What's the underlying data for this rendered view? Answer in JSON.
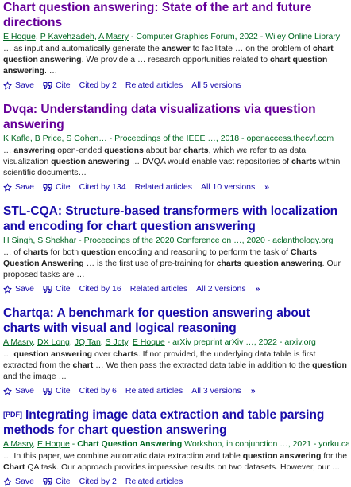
{
  "results": [
    {
      "pdf": "",
      "title": [
        [
          "Chart question answering",
          true
        ],
        [
          ": State of the art and future directions",
          false
        ]
      ],
      "visited": true,
      "authors": [
        "E Hoque",
        "P Kavehzadeh",
        "A Masry"
      ],
      "source": " - Computer Graphics Forum, 2022 - Wiley Online Library",
      "snippet": [
        [
          "… as input and automatically generate the ",
          false
        ],
        [
          "answer",
          true
        ],
        [
          " to facilitate … on the problem of ",
          false
        ],
        [
          "chart question answering",
          true
        ],
        [
          ". We provide a … research opportunities related to ",
          false
        ],
        [
          "chart question answering",
          true
        ],
        [
          ". …",
          false
        ]
      ],
      "save": "Save",
      "cite": "Cite",
      "cited_by": "Cited by 2",
      "related": "Related articles",
      "versions": "All 5 versions",
      "has_more": false
    },
    {
      "pdf": "",
      "title": [
        [
          "Dvqa: Understanding data visualizations via ",
          false
        ],
        [
          "question answering",
          true
        ]
      ],
      "visited": true,
      "authors": [
        "K Kafle",
        "B Price",
        "S Cohen…"
      ],
      "source": " - Proceedings of the IEEE …, 2018 - openaccess.thecvf.com",
      "snippet": [
        [
          "… ",
          false
        ],
        [
          "answering",
          true
        ],
        [
          " open-ended ",
          false
        ],
        [
          "questions",
          true
        ],
        [
          " about bar ",
          false
        ],
        [
          "charts",
          true
        ],
        [
          ", which we refer to as data visualization ",
          false
        ],
        [
          "question answering",
          true
        ],
        [
          " … DVQA would enable vast repositories of ",
          false
        ],
        [
          "charts",
          true
        ],
        [
          " within scientific documents…",
          false
        ]
      ],
      "save": "Save",
      "cite": "Cite",
      "cited_by": "Cited by 134",
      "related": "Related articles",
      "versions": "All 10 versions",
      "has_more": true
    },
    {
      "pdf": "",
      "title": [
        [
          "STL-CQA: Structure-based transformers with localization and encoding for ",
          false
        ],
        [
          "chart question answering",
          true
        ]
      ],
      "visited": false,
      "authors": [
        "H Singh",
        "S Shekhar"
      ],
      "source": " - Proceedings of the 2020 Conference on …, 2020 - aclanthology.org",
      "snippet": [
        [
          "… of ",
          false
        ],
        [
          "charts",
          true
        ],
        [
          " for both ",
          false
        ],
        [
          "question",
          true
        ],
        [
          " encoding and reasoning to perform the task of ",
          false
        ],
        [
          "Charts Question Answering",
          true
        ],
        [
          " … is the first use of pre-training for ",
          false
        ],
        [
          "charts question answering",
          true
        ],
        [
          ". Our proposed tasks are …",
          false
        ]
      ],
      "save": "Save",
      "cite": "Cite",
      "cited_by": "Cited by 16",
      "related": "Related articles",
      "versions": "All 2 versions",
      "has_more": true
    },
    {
      "pdf": "",
      "title": [
        [
          "Chartqa: A benchmark for ",
          false
        ],
        [
          "question answering",
          true
        ],
        [
          " about ",
          false
        ],
        [
          "charts",
          true
        ],
        [
          " with visual and logical reasoning",
          false
        ]
      ],
      "visited": false,
      "authors": [
        "A Masry",
        "DX Long",
        "JQ Tan",
        "S Joty",
        "E Hoque"
      ],
      "source": " - arXiv preprint arXiv …, 2022 - arxiv.org",
      "snippet": [
        [
          "… ",
          false
        ],
        [
          "question answering",
          true
        ],
        [
          " over ",
          false
        ],
        [
          "charts",
          true
        ],
        [
          ". If not provided, the underlying data table is first extracted from the ",
          false
        ],
        [
          "chart",
          true
        ],
        [
          " … We then pass the extracted data table in addition to the ",
          false
        ],
        [
          "question",
          true
        ],
        [
          " and the image …",
          false
        ]
      ],
      "save": "Save",
      "cite": "Cite",
      "cited_by": "Cited by 6",
      "related": "Related articles",
      "versions": "All 3 versions",
      "has_more": true
    },
    {
      "pdf": "[PDF]",
      "title": [
        [
          "Integrating image data extraction and table parsing methods for ",
          false
        ],
        [
          "chart question answering",
          true
        ]
      ],
      "visited": false,
      "authors": [
        "A Masry",
        "E Hoque"
      ],
      "source_html": [
        [
          " - ",
          false
        ],
        [
          "Chart Question Answering",
          true
        ],
        [
          " Workshop, in conjunction …, 2021 - yorku.ca",
          false
        ]
      ],
      "snippet": [
        [
          "… In this paper, we combine automatic data extraction and table ",
          false
        ],
        [
          "question answering",
          true
        ],
        [
          " for the ",
          false
        ],
        [
          "Chart",
          true
        ],
        [
          " QA task. Our approach provides impressive results on two datasets. However, our …",
          false
        ]
      ],
      "save": "Save",
      "cite": "Cite",
      "cited_by": "Cited by 2",
      "related": "Related articles",
      "versions": "",
      "has_more": false
    }
  ],
  "icons": {
    "save": "star-icon",
    "cite": "quote-icon",
    "more": "double-chevron-icon"
  },
  "colors": {
    "link": "#1a0dab",
    "visited": "#660099",
    "meta": "#006621",
    "text": "#222222"
  }
}
